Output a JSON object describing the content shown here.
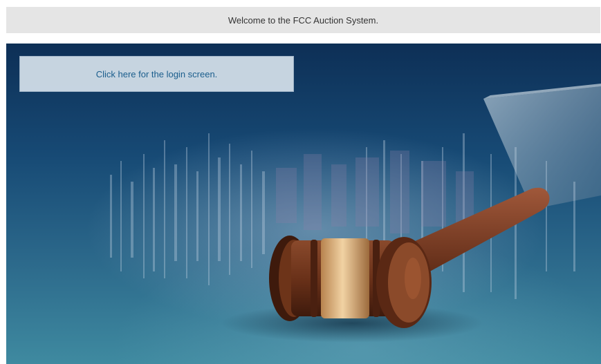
{
  "header": {
    "welcome_text": "Welcome to the FCC Auction System."
  },
  "hero": {
    "image": "gavel-image",
    "login_link_label": "Click here for the login screen."
  },
  "colors": {
    "welcome_bar": "#e5e5e5",
    "link": "#1a5d8c",
    "hero_dark": "#0d2f56",
    "hero_light": "#3f8aa0"
  }
}
